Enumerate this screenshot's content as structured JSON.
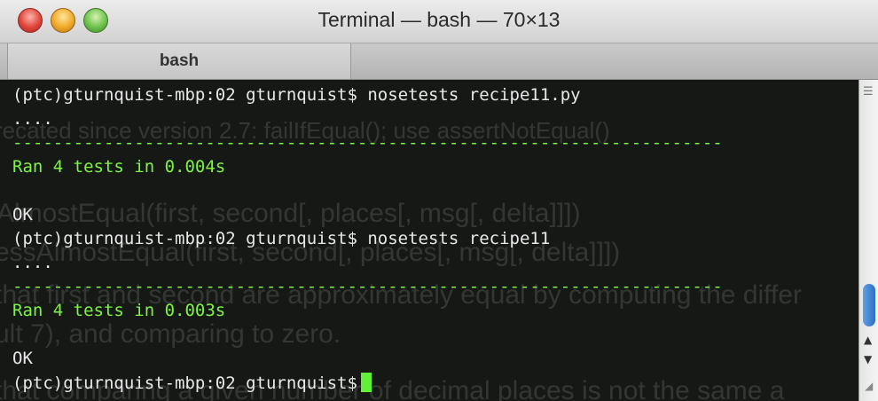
{
  "window": {
    "title": "Terminal — bash — 70×13",
    "tab_label": "bash"
  },
  "terminal": {
    "lines": [
      {
        "text": "(ptc)gturnquist-mbp:02 gturnquist$ nosetests recipe11.py",
        "color": "#e8e8e8"
      },
      {
        "text": "....",
        "color": "#e8e8e8"
      },
      {
        "text": "----------------------------------------------------------------------",
        "color": "#7cf542"
      },
      {
        "text": "Ran 4 tests in 0.004s",
        "color": "#7cf542"
      },
      {
        "text": "",
        "color": "#e8e8e8"
      },
      {
        "text": "OK",
        "color": "#e8e8e8"
      },
      {
        "text": "(ptc)gturnquist-mbp:02 gturnquist$ nosetests recipe11",
        "color": "#e8e8e8"
      },
      {
        "text": "....",
        "color": "#e8e8e8"
      },
      {
        "text": "----------------------------------------------------------------------",
        "color": "#7cf542"
      },
      {
        "text": "Ran 4 tests in 0.003s",
        "color": "#7cf542"
      },
      {
        "text": "",
        "color": "#e8e8e8"
      },
      {
        "text": "OK",
        "color": "#e8e8e8"
      },
      {
        "text": "(ptc)gturnquist-mbp:02 gturnquist$",
        "color": "#e8e8e8"
      }
    ],
    "background_ghost_text": [
      "recated since version 2.7: failIfEqual(); use assertNotEqual()",
      "AlmostEqual(first, second[, places[, msg[, delta]]])",
      "essAlmostEqual(first, second[, places[, msg[, delta]]])",
      "that first and second are approximately equal by computing the differ",
      "ult 7), and comparing to zero.",
      "that comparing a given number of decimal places is not the same a"
    ]
  },
  "colors": {
    "terminal_bg": "#161816",
    "output_green": "#7cf542",
    "cursor": "#5ff236"
  }
}
